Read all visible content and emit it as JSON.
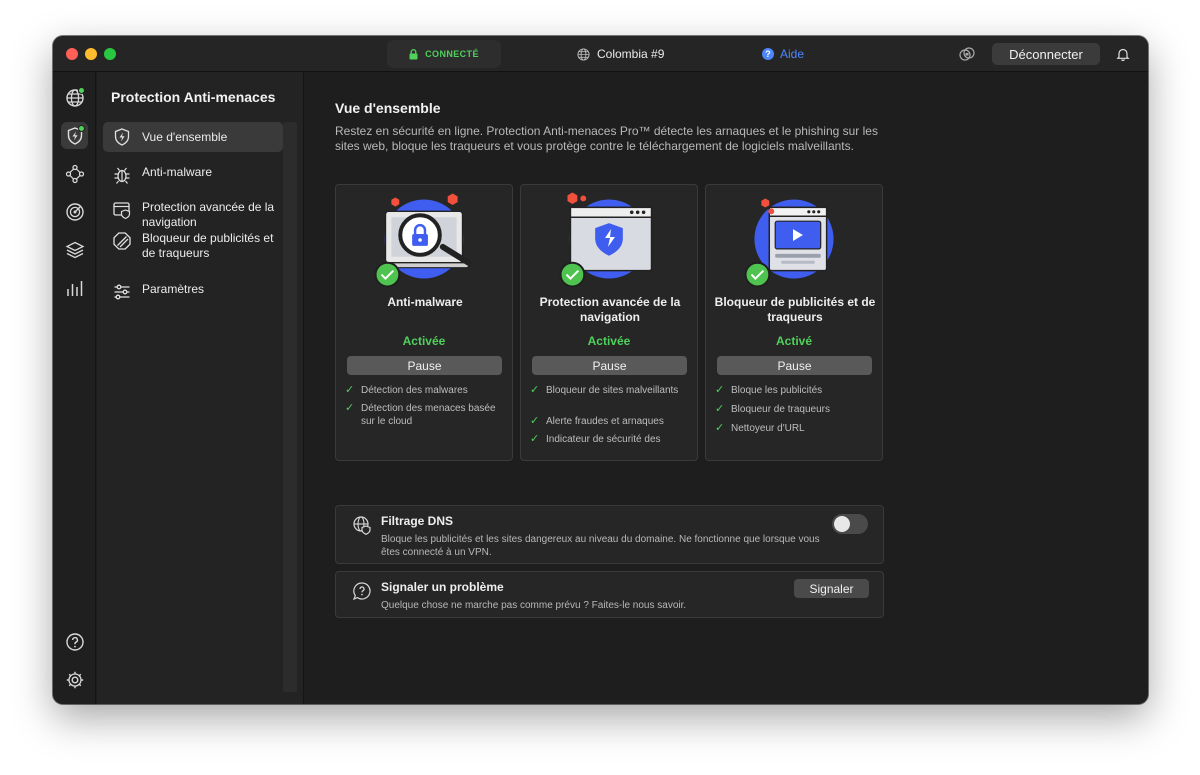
{
  "titlebar": {
    "status": "CONNECTÉ",
    "location": "Colombia #9",
    "help": "Aide",
    "disconnect": "Déconnecter"
  },
  "sidebar": {
    "title": "Protection Anti-menaces",
    "items": [
      {
        "label": "Vue d'ensemble",
        "icon": "shield-bolt-icon"
      },
      {
        "label": "Anti-malware",
        "icon": "bug-icon"
      },
      {
        "label": "Protection avancée de la navigation",
        "icon": "browser-shield-icon"
      },
      {
        "label": "Bloqueur de publicités et de traqueurs",
        "icon": "block-icon"
      },
      {
        "label": "Paramètres",
        "icon": "sliders-icon"
      }
    ]
  },
  "main": {
    "title": "Vue d'ensemble",
    "description": "Restez en sécurité en ligne. Protection Anti-menaces Pro™ détecte les arnaques et le phishing sur les sites web, bloque les traqueurs et vous protège contre le téléchargement de logiciels malveillants.",
    "cards": [
      {
        "title": "Anti-malware",
        "status": "Activée",
        "button": "Pause",
        "features": [
          "Détection des malwares",
          "Détection des menaces basée sur le cloud"
        ]
      },
      {
        "title": "Protection avancée de la navigation",
        "status": "Activée",
        "button": "Pause",
        "features": [
          "Bloqueur de sites malveillants",
          "Alerte fraudes et arnaques",
          "Indicateur de sécurité des"
        ]
      },
      {
        "title": "Bloqueur de publicités et de traqueurs",
        "status": "Activé",
        "button": "Pause",
        "features": [
          "Bloque les publicités",
          "Bloqueur de traqueurs",
          "Nettoyeur d'URL"
        ]
      }
    ],
    "dns": {
      "title": "Filtrage DNS",
      "description": "Bloque les publicités et les sites dangereux au niveau du domaine. Ne fonctionne que lorsque vous êtes connecté à un VPN.",
      "enabled": false
    },
    "report": {
      "title": "Signaler un problème",
      "description": "Quelque chose ne marche pas comme prévu ? Faites-le nous savoir.",
      "button": "Signaler"
    }
  },
  "colors": {
    "accent_green": "#4fd15c",
    "accent_blue": "#4e86ff",
    "illustration_blue": "#3f5ef0",
    "illustration_red": "#f0503c"
  }
}
